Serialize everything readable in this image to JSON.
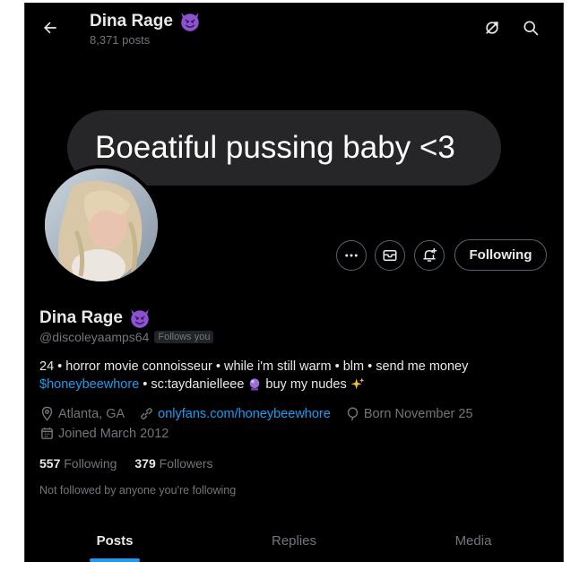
{
  "header": {
    "name": "Dina Rage",
    "posts_count": "8,371 posts"
  },
  "banner": {
    "bubble_text": "Boeatiful pussing baby <3"
  },
  "actions": {
    "follow_label": "Following"
  },
  "profile": {
    "display_name": "Dina Rage",
    "handle": "@discoleyaamps64",
    "follows_you": "Follows you",
    "bio_line1": "24 • horror movie connoisseur • while i'm still warm • blm • send me money",
    "bio_cashtag": "$honeybeewhore",
    "bio_line2": " • sc:taydanielleee",
    "bio_line2b": " buy my nudes ",
    "location": "Atlanta, GA",
    "website": "onlyfans.com/honeybeewhore",
    "birthday": "Born November 25",
    "joined": "Joined March 2012"
  },
  "stats": {
    "following_count": "557",
    "following_label": "Following",
    "followers_count": "379",
    "followers_label": "Followers"
  },
  "not_followed_text": "Not followed by anyone you're following",
  "tabs": [
    {
      "label": "Posts",
      "active": true
    },
    {
      "label": "Replies",
      "active": false
    },
    {
      "label": "Media",
      "active": false
    }
  ],
  "colors": {
    "accent": "#1d9bf0",
    "background": "#000000",
    "secondary_text": "#71767b",
    "emoji_devil": "#8c52d1"
  },
  "icons": [
    "back-arrow-icon",
    "devil-emoji-icon",
    "subscribe-icon",
    "search-icon",
    "more-icon",
    "message-icon",
    "notify-icon",
    "location-icon",
    "link-icon",
    "birthday-icon",
    "calendar-icon",
    "crystal-ball-emoji-icon",
    "sparkles-emoji-icon"
  ]
}
